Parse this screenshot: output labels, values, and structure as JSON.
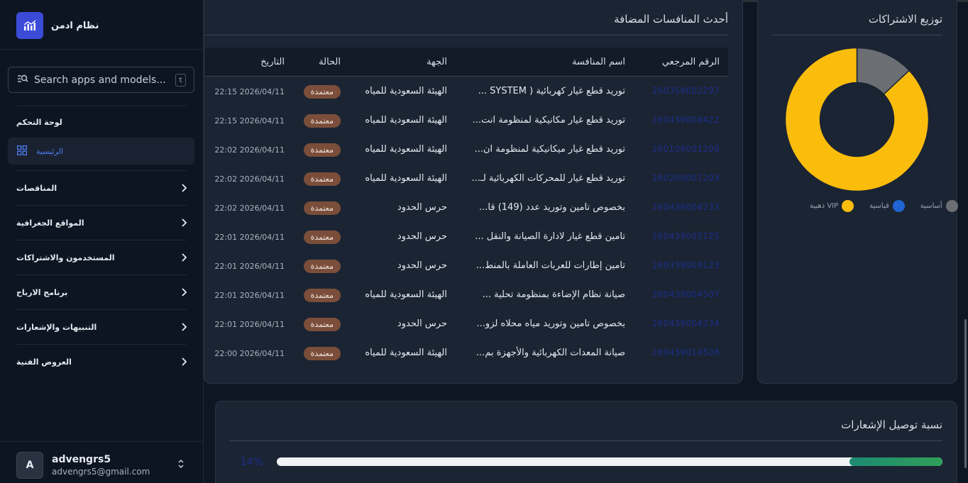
{
  "app": {
    "brand_name": "نظام ادمن",
    "search_placeholder": "Search apps and models...",
    "search_shortcut": "t"
  },
  "sidebar": {
    "section_label": "لوحة التحكم",
    "active_item": "الرئيسية",
    "items": [
      {
        "label": "المناقصات"
      },
      {
        "label": "المواقع الجغرافية"
      },
      {
        "label": "المستخدمون والاشتراكات"
      },
      {
        "label": "برنامج الارباح"
      },
      {
        "label": "التنبيهات والإشعارات"
      },
      {
        "label": "العروض الفنية"
      }
    ],
    "user": {
      "initial": "A",
      "name": "advengrs5",
      "email": "advengrs5@gmail.com"
    }
  },
  "tenders": {
    "title": "أحدث المنافسات المضافة",
    "columns": {
      "ref": "الرقم المرجعي",
      "name": "اسم المنافسة",
      "entity": "الجهة",
      "status": "الحالة",
      "date": "التاريخ"
    },
    "rows": [
      {
        "ref": "260359002297",
        "name": "توريد قطع غيار كهربائية ( SYSTEM ...",
        "entity": "الهيئة السعودية للمياه",
        "status": "معتمدة",
        "date": "2026/04/11 22:15"
      },
      {
        "ref": "260439009422",
        "name": "توريد قطع غيار مكانيكية لمنظومة انت...",
        "entity": "الهيئة السعودية للمياه",
        "status": "معتمدة",
        "date": "2026/04/11 22:15"
      },
      {
        "ref": "260109001200",
        "name": "توريد قطع غيار ميكانيكية لمنظومة ان...",
        "entity": "الهيئة السعودية للمياه",
        "status": "معتمدة",
        "date": "2026/04/11 22:02"
      },
      {
        "ref": "260209001203",
        "name": "توريد قطع غيار للمحركات الكهربائية لـ...",
        "entity": "الهيئة السعودية للمياه",
        "status": "معتمدة",
        "date": "2026/04/11 22:02"
      },
      {
        "ref": "260439004233",
        "name": "بخصوص تامين وتوريد عدد (149) قا...",
        "entity": "حرس الحدود",
        "status": "معتمدة",
        "date": "2026/04/11 22:02"
      },
      {
        "ref": "260439005125",
        "name": "تامين قطع غيار لادارة الصيانة والنقل ...",
        "entity": "حرس الحدود",
        "status": "معتمدة",
        "date": "2026/04/11 22:01"
      },
      {
        "ref": "260339009123",
        "name": "تامين إطارات للعربات العاملة بالمنط...",
        "entity": "حرس الحدود",
        "status": "معتمدة",
        "date": "2026/04/11 22:01"
      },
      {
        "ref": "260439004507",
        "name": "صيانة نظام الإضاءة بمنظومة تحلية ...",
        "entity": "الهيئة السعودية للمياه",
        "status": "معتمدة",
        "date": "2026/04/11 22:01"
      },
      {
        "ref": "260439004234",
        "name": "بخصوص تامين وتوريد مياه محلاه لزو...",
        "entity": "حرس الحدود",
        "status": "معتمدة",
        "date": "2026/04/11 22:01"
      },
      {
        "ref": "260439014508",
        "name": "صيانة المعدات الكهربائية والأجهزة بم...",
        "entity": "الهيئة السعودية للمياه",
        "status": "معتمدة",
        "date": "2026/04/11 22:00"
      }
    ]
  },
  "subscriptions": {
    "title": "توزيع الاشتراكات",
    "colors": {
      "vip": "#fbbd0c",
      "basic": "#6b6f74",
      "premium": "#1f64d0"
    },
    "legend": [
      {
        "label": "أساسية",
        "color": "#6b6f74"
      },
      {
        "label": "قياسية",
        "color": "#1f64d0"
      },
      {
        "label": "VIP ذهبية",
        "color": "#fbbd0c"
      }
    ],
    "shares": {
      "vip": 0.87,
      "basic": 0.13,
      "premium": 0.0
    }
  },
  "notifications": {
    "title": "نسبة توصيل الإشعارات",
    "percent_label": "14%",
    "fill_fraction": 0.14
  }
}
